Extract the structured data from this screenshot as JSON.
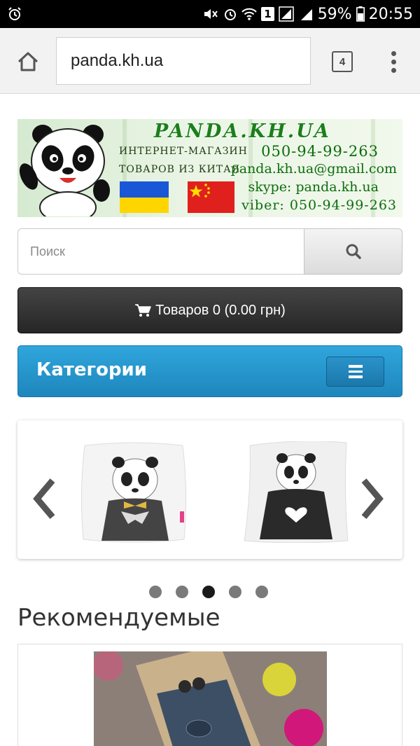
{
  "status_bar": {
    "battery_percent": "59%",
    "time": "20:55",
    "sim_number": "1",
    "icons": [
      "alarm-icon",
      "mute-icon",
      "alarm-clock-icon",
      "wifi-icon",
      "sim-icon",
      "signal-icon",
      "battery-icon"
    ]
  },
  "browser": {
    "url": "panda.kh.ua",
    "tab_count": "4",
    "icons": [
      "home-icon",
      "tabs-icon",
      "overflow-menu-icon"
    ]
  },
  "banner": {
    "site_title": "PANDA.KH.UA",
    "shop_line1": "ИНТЕРНЕТ-МАГАЗИН",
    "shop_line2": "ТОВАРОВ ИЗ КИТАЯ",
    "phone": "050-94-99-263",
    "email": "panda.kh.ua@gmail.com",
    "skype": "skype: panda.kh.ua",
    "viber": "viber: 050-94-99-263",
    "flags": [
      "ukraine-flag",
      "china-flag"
    ]
  },
  "search": {
    "placeholder": "Поиск",
    "icon": "search-icon"
  },
  "cart": {
    "label": "Товаров 0 (0.00 грн)",
    "icon": "cart-icon"
  },
  "categories": {
    "title": "Категории",
    "toggle_icon": "hamburger-icon"
  },
  "carousel": {
    "items": [
      "panda-bowtie-pillow",
      "panda-heart-pillow"
    ],
    "dots_count": 5,
    "active_dot_index": 2
  },
  "recommended": {
    "title": "Рекомендуемые"
  },
  "colors": {
    "categories_blue": "#2497cf",
    "cart_dark": "#2e2e2e",
    "banner_green": "#1b7f1b",
    "status_bar": "#000000"
  }
}
